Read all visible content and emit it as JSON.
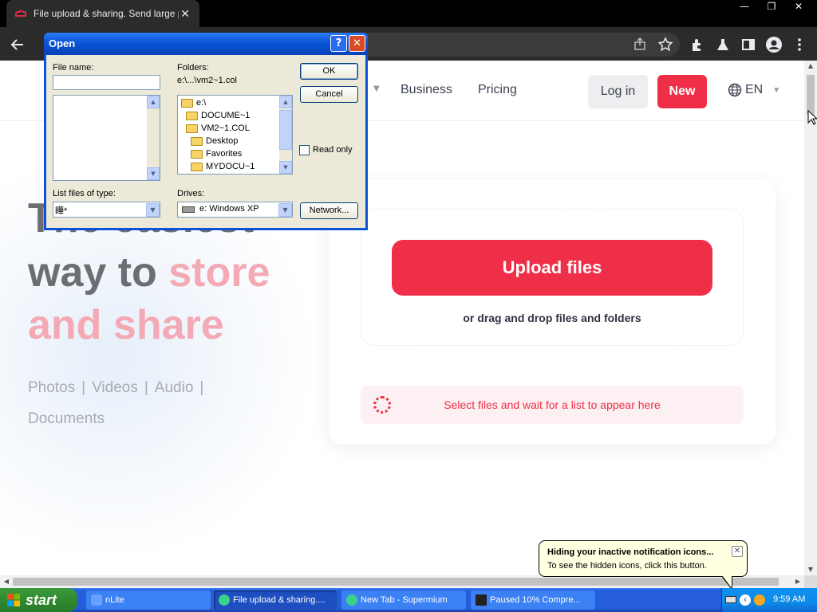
{
  "browser": {
    "tab_title": "File upload & sharing. Send large ph",
    "tab_close": "✕",
    "window_controls": {
      "minimize": "—",
      "restore": "❐",
      "close": "✕"
    },
    "toolbar_icons": [
      "back-icon",
      "share-icon",
      "star-icon",
      "extensions-icon",
      "flask-icon",
      "sidebar-icon",
      "profile-icon",
      "menu-icon"
    ]
  },
  "site": {
    "nav": {
      "business": "Business",
      "pricing": "Pricing",
      "login": "Log in",
      "new": "New",
      "lang": "EN"
    },
    "hero": {
      "line1": "The easiest",
      "line2a": "way to ",
      "line2b": "store",
      "line3": "and share"
    },
    "types": {
      "photos": "Photos",
      "videos": "Videos",
      "audio": "Audio",
      "documents": "Documents",
      "sep": "|"
    },
    "upload": {
      "button": "Upload files",
      "drag": "or drag and drop files and folders",
      "list_msg": "Select files and wait for a list to appear here"
    },
    "colors": {
      "accent": "#ef2f47",
      "hero_grey": "#6d6e72",
      "hero_pink": "#f3aab5"
    }
  },
  "dialog": {
    "title": "Open",
    "help": "?",
    "close": "✕",
    "file_name_label": "File name:",
    "file_name_value": "",
    "folders_label": "Folders:",
    "folders_path": "e:\\...\\vm2~1.col",
    "folders": [
      "e:\\",
      "DOCUME~1",
      "VM2~1.COL",
      "Desktop",
      "Favorites",
      "MYDOCU~1"
    ],
    "ok": "OK",
    "cancel": "Cancel",
    "read_only": "Read only",
    "list_type_label": "List files of type:",
    "list_type_value": "瞱*",
    "drives_label": "Drives:",
    "drives_value": "e: Windows XP",
    "network": "Network..."
  },
  "taskbar": {
    "start": "start",
    "tasks": [
      {
        "label": "nLite",
        "active": false
      },
      {
        "label": "File upload & sharing....",
        "active": true
      },
      {
        "label": "New Tab - Supermium",
        "active": false
      },
      {
        "label": "Paused 10% Compre...",
        "active": false
      }
    ],
    "clock": "9:59 AM"
  },
  "balloon": {
    "title": "Hiding your inactive notification icons...",
    "body": "To see the hidden icons, click this button.",
    "close": "✕"
  }
}
